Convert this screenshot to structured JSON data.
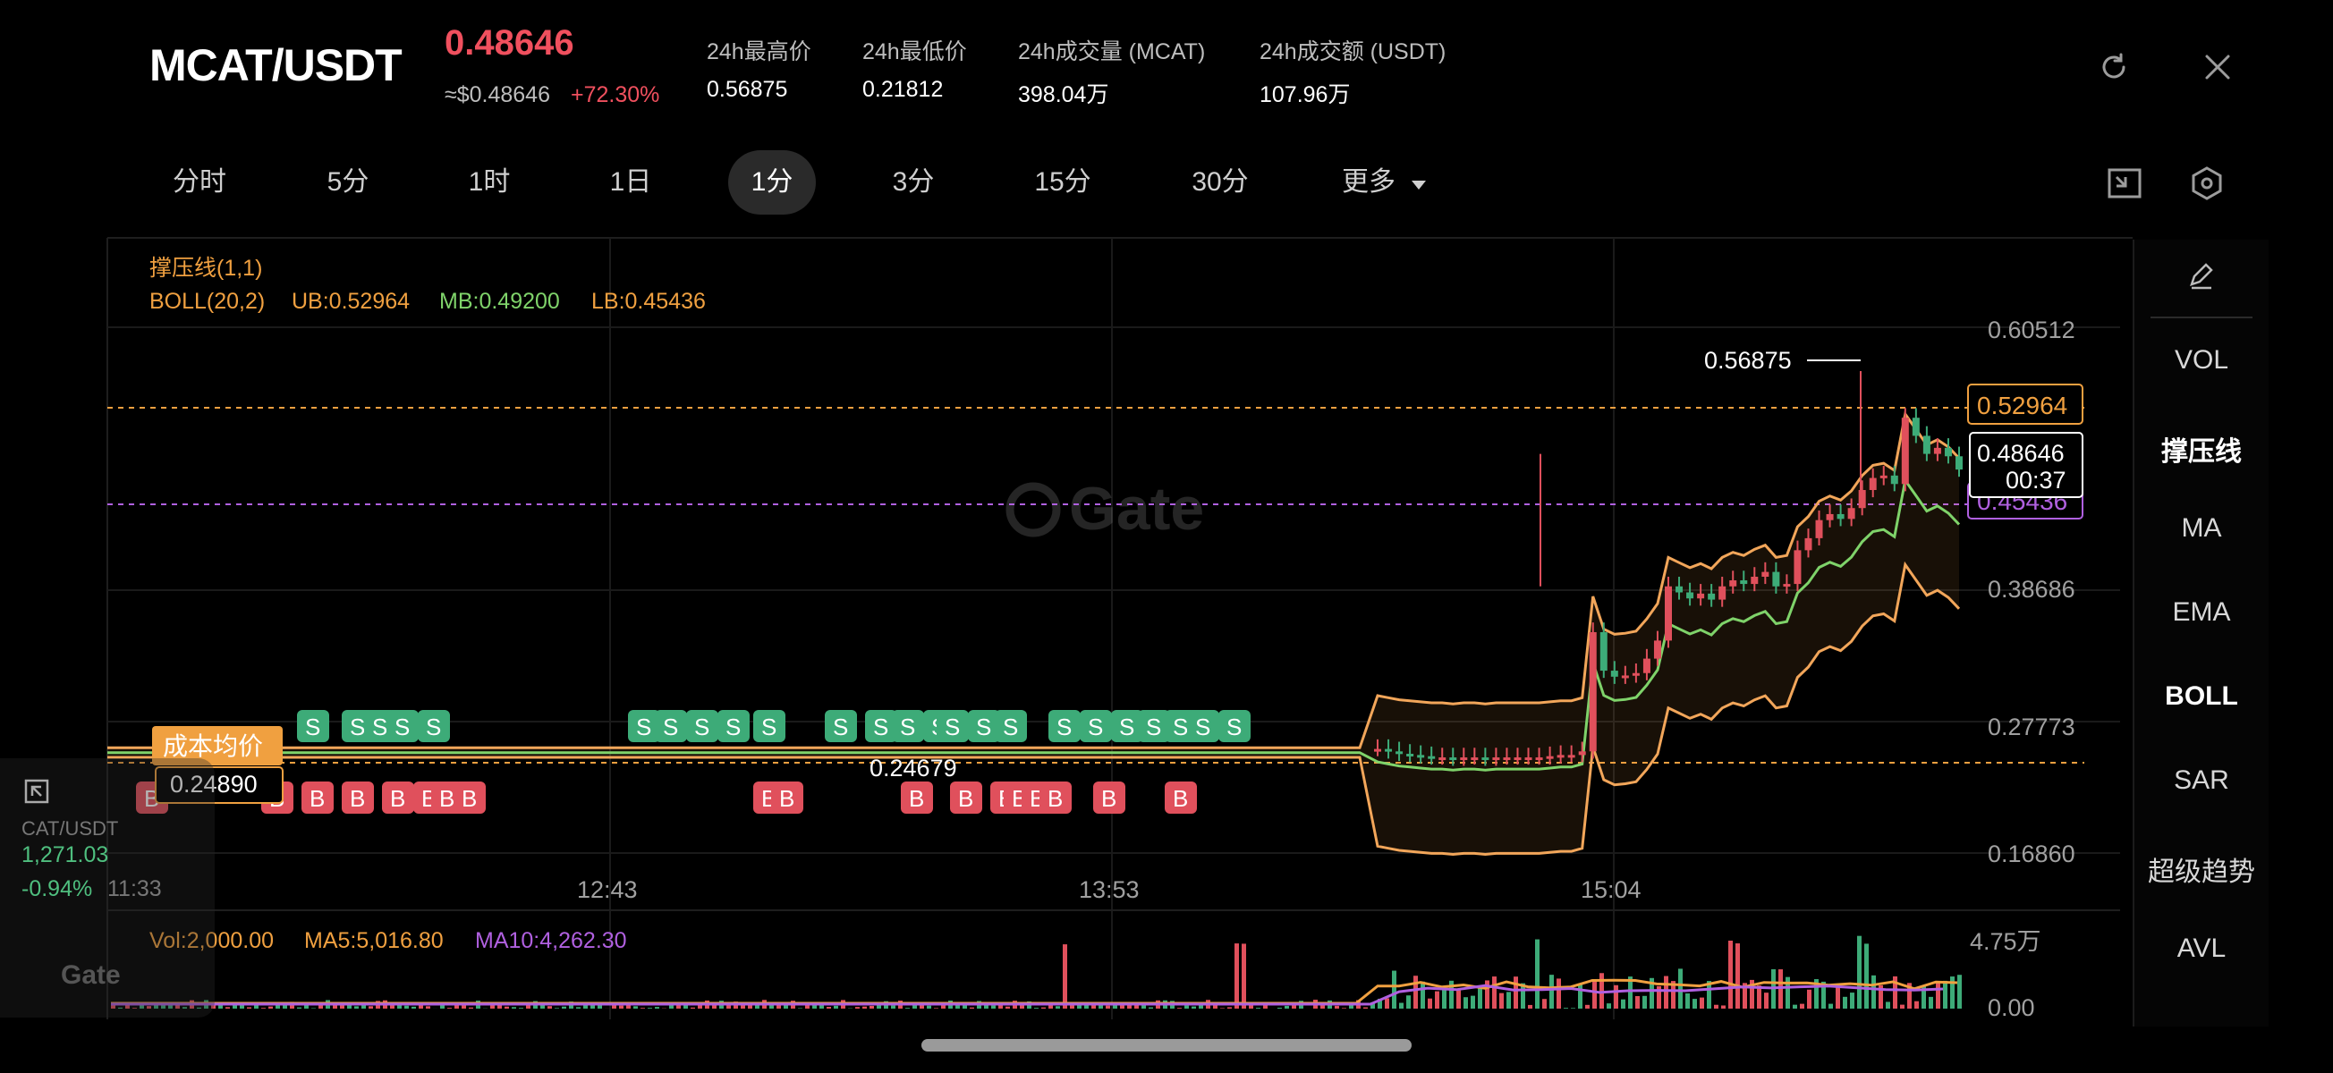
{
  "header": {
    "pair": "MCAT/USDT",
    "price": "0.48646",
    "usd_price": "≈$0.48646",
    "change": "+72.30%",
    "stats": [
      {
        "label": "24h最高价",
        "value": "0.56875"
      },
      {
        "label": "24h最低价",
        "value": "0.21812"
      },
      {
        "label": "24h成交量 (MCAT)",
        "value": "398.04万"
      },
      {
        "label": "24h成交额 (USDT)",
        "value": "107.96万"
      }
    ],
    "icons": [
      "refresh-icon",
      "close-icon"
    ]
  },
  "tabs": [
    {
      "label": "分时",
      "active": false
    },
    {
      "label": "5分",
      "active": false
    },
    {
      "label": "1时",
      "active": false
    },
    {
      "label": "1日",
      "active": false
    },
    {
      "label": "1分",
      "active": true
    },
    {
      "label": "3分",
      "active": false
    },
    {
      "label": "15分",
      "active": false
    },
    {
      "label": "30分",
      "active": false
    },
    {
      "label": "更多",
      "active": false
    }
  ],
  "indicators": {
    "sr_label": "撑压线(1,1)",
    "boll_label": "BOLL(20,2)",
    "ub": "UB:0.52964",
    "mb": "MB:0.49200",
    "lb": "LB:0.45436"
  },
  "price_axis": [
    "0.60512",
    "0.38686",
    "0.27773",
    "0.16860"
  ],
  "time_axis": [
    "12:43",
    "13:53",
    "15:04"
  ],
  "tags": {
    "high_label": "0.56875",
    "ub_tag": "0.52964",
    "current_price_tag": "0.48646",
    "countdown": "00:37",
    "lb_tag": "0.45436",
    "cost_avg_label": "成本均价",
    "cost_avg_value": "0.24890",
    "low_label": "0.24679",
    "watermark": "Gate"
  },
  "volume": {
    "vol": "Vol:2,000.00",
    "ma5": "MA5:5,016.80",
    "ma10": "MA10:4,262.30",
    "axis_top": "4.75万",
    "axis_bottom": "0.00"
  },
  "right_panel": [
    {
      "label": "VOL",
      "active": false
    },
    {
      "label": "撑压线",
      "active": true
    },
    {
      "label": "MA",
      "active": false
    },
    {
      "label": "EMA",
      "active": false
    },
    {
      "label": "BOLL",
      "active": true
    },
    {
      "label": "SAR",
      "active": false
    },
    {
      "label": "超级趋势",
      "active": false
    },
    {
      "label": "AVL",
      "active": false
    }
  ],
  "widget": {
    "pair": "CAT/USDT",
    "price": "1,271.03",
    "change": "-0.94%",
    "time": "11:33",
    "logo": "Gate"
  },
  "colors": {
    "up": "#e0505c",
    "down": "#3dab78",
    "ub_line": "#f2a65a",
    "mb_line": "#7fd36a",
    "lb_line": "#b060e0",
    "accent_orange": "#f0a040"
  },
  "chart_data": {
    "type": "candlestick",
    "ylim": [
      0.1686,
      0.60512
    ],
    "y_ticks": [
      0.60512,
      0.38686,
      0.27773,
      0.1686
    ],
    "x_ticks": [
      "12:43",
      "13:53",
      "15:04"
    ],
    "close_series": [
      0.255,
      0.253,
      0.251,
      0.25,
      0.249,
      0.248,
      0.248,
      0.247,
      0.248,
      0.248,
      0.247,
      0.248,
      0.248,
      0.248,
      0.248,
      0.248,
      0.249,
      0.25,
      0.25,
      0.253,
      0.352,
      0.32,
      0.315,
      0.316,
      0.318,
      0.33,
      0.345,
      0.39,
      0.385,
      0.38,
      0.384,
      0.379,
      0.39,
      0.395,
      0.392,
      0.398,
      0.402,
      0.39,
      0.392,
      0.42,
      0.43,
      0.445,
      0.45,
      0.446,
      0.455,
      0.47,
      0.48,
      0.482,
      0.475,
      0.53,
      0.515,
      0.5,
      0.505,
      0.498,
      0.487
    ],
    "markers_sell": 24,
    "markers_buy": 20
  }
}
